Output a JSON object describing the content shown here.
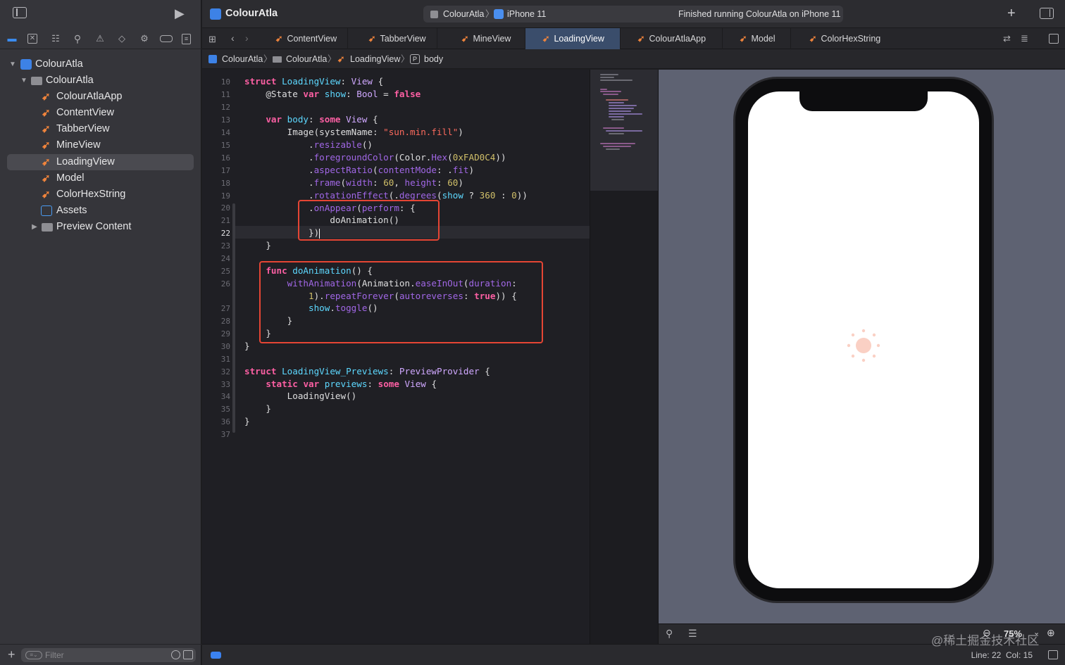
{
  "project": {
    "name": "ColourAtla"
  },
  "toolbar": {
    "scheme_project": "ColourAtla",
    "scheme_device": "iPhone 11",
    "status": "Finished running ColourAtla on iPhone 11",
    "add_label": "+"
  },
  "navigator": {
    "root": "ColourAtla",
    "group": "ColourAtla",
    "files": [
      {
        "label": "ColourAtlaApp",
        "icon": "swift-file-icon"
      },
      {
        "label": "ContentView",
        "icon": "swift-file-icon"
      },
      {
        "label": "TabberView",
        "icon": "swift-file-icon"
      },
      {
        "label": "MineView",
        "icon": "swift-file-icon"
      },
      {
        "label": "LoadingView",
        "icon": "swift-file-icon",
        "selected": true
      },
      {
        "label": "Model",
        "icon": "swift-file-icon"
      },
      {
        "label": "ColorHexString",
        "icon": "swift-file-icon"
      },
      {
        "label": "Assets",
        "icon": "asset-catalog-icon"
      },
      {
        "label": "Preview Content",
        "icon": "folder-icon"
      }
    ],
    "filter_placeholder": "Filter"
  },
  "tabs": [
    {
      "label": "ContentView",
      "active": false
    },
    {
      "label": "TabberView",
      "active": false
    },
    {
      "label": "MineView",
      "active": false
    },
    {
      "label": "LoadingView",
      "active": true
    },
    {
      "label": "ColourAtlaApp",
      "active": false
    },
    {
      "label": "Model",
      "active": false
    },
    {
      "label": "ColorHexString",
      "active": false
    }
  ],
  "breadcrumb": {
    "project": "ColourAtla",
    "group": "ColourAtla",
    "file": "LoadingView",
    "symbol_badge": "P",
    "symbol": "body"
  },
  "editor": {
    "current_line": "22",
    "line_numbers": [
      "10",
      "11",
      "12",
      "13",
      "14",
      "15",
      "16",
      "17",
      "18",
      "19",
      "20",
      "21",
      "22",
      "23",
      "24",
      "25",
      "26",
      "",
      "27",
      "28",
      "29",
      "30",
      "31",
      "32",
      "33",
      "34",
      "35",
      "36",
      "37"
    ],
    "code": {
      "l10": {
        "a": "struct",
        "b": " LoadingView",
        "c": ": ",
        "d": "View",
        "e": " {"
      },
      "l11": {
        "a": "    @State ",
        "b": "var",
        "c": " show",
        "d": ": ",
        "e": "Bool",
        "f": " = ",
        "g": "false"
      },
      "l13": {
        "a": "    ",
        "b": "var",
        "c": " body",
        "d": ": ",
        "e": "some",
        "f": " ",
        "g": "View",
        "h": " {"
      },
      "l14": {
        "a": "        Image(systemName: ",
        "b": "\"sun.min.fill\"",
        "c": ")"
      },
      "l15": {
        "a": "            .",
        "b": "resizable",
        "c": "()"
      },
      "l16": {
        "a": "            .",
        "b": "foregroundColor",
        "c": "(Color.",
        "d": "Hex",
        "e": "(",
        "f": "0xFAD0C4",
        "g": "))"
      },
      "l17": {
        "a": "            .",
        "b": "aspectRatio",
        "c": "(",
        "d": "contentMode",
        "e": ": .",
        "f": "fit",
        "g": ")"
      },
      "l18": {
        "a": "            .",
        "b": "frame",
        "c": "(",
        "d": "width",
        "e": ": ",
        "f": "60",
        "g": ", ",
        "h": "height",
        "i": ": ",
        "j": "60",
        "k": ")"
      },
      "l19": {
        "a": "            .",
        "b": "rotationEffect",
        "c": "(.",
        "d": "degrees",
        "e": "(",
        "f": "show",
        "g": " ? ",
        "h": "360",
        "i": " : ",
        "j": "0",
        "k": "))"
      },
      "l20": {
        "a": "            .",
        "b": "onAppear",
        "c": "(",
        "d": "perform",
        "e": ": {"
      },
      "l21": {
        "a": "                doAnimation()"
      },
      "l22": {
        "a": "            })"
      },
      "l23": {
        "a": "    }"
      },
      "l25": {
        "a": "    ",
        "b": "func",
        "c": " doAnimation",
        "d": "() {"
      },
      "l26": {
        "a": "        ",
        "b": "withAnimation",
        "c": "(Animation.",
        "d": "easeInOut",
        "e": "(",
        "f": "duration",
        "g": ":"
      },
      "l26b": {
        "a": "            ",
        "b": "1",
        "c": ").",
        "d": "repeatForever",
        "e": "(",
        "f": "autoreverses",
        "g": ": ",
        "h": "true",
        "i": ")) {"
      },
      "l27": {
        "a": "            ",
        "b": "show",
        "c": ".",
        "d": "toggle",
        "e": "()"
      },
      "l28": {
        "a": "        }"
      },
      "l29": {
        "a": "    }"
      },
      "l30": {
        "a": "}"
      },
      "l32": {
        "a": "struct",
        "b": " LoadingView_Previews",
        "c": ": ",
        "d": "PreviewProvider",
        "e": " {"
      },
      "l33": {
        "a": "    ",
        "b": "static",
        "c": " ",
        "d": "var",
        "e": " previews",
        "f": ": ",
        "g": "some",
        "h": " ",
        "i": "View",
        "j": " {"
      },
      "l34": {
        "a": "        LoadingView()"
      },
      "l35": {
        "a": "    }"
      },
      "l36": {
        "a": "}"
      }
    }
  },
  "preview": {
    "zoom": "75%",
    "sun_color": "#FAD0C4"
  },
  "status_bar": {
    "line_label": "Line: 22",
    "col_label": "Col: 15"
  },
  "watermark": "@稀土掘金技术社区",
  "colors": {
    "keyword": "#fc5fa3",
    "type": "#5dd8ff",
    "string": "#fc6a5d",
    "number": "#d0bf69",
    "highlight_box": "#e54534",
    "swift_icon": "#f0843c"
  }
}
